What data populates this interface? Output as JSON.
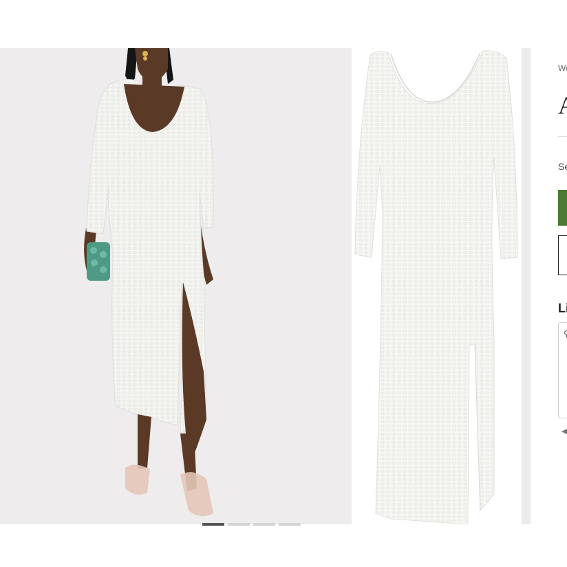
{
  "product": {
    "breadcrumb": "Wo",
    "title": "A",
    "size_label": "Se",
    "section_title": "Li"
  },
  "gallery": {
    "slide_count": 4,
    "active_slide": 1,
    "images": [
      {
        "name": "model-photo"
      },
      {
        "name": "flat-photo"
      }
    ]
  },
  "icons": {
    "box_icon": "search-icon",
    "prev_icon": "chevron-left-icon"
  },
  "glyphs": {
    "box_icon": "⚲",
    "prev_arrow": "◀"
  },
  "colors": {
    "accent_green": "#4a7a34",
    "page_bg": "#ffffff",
    "photo_bg": "#eeecec",
    "dress": "#f4f4f1"
  }
}
